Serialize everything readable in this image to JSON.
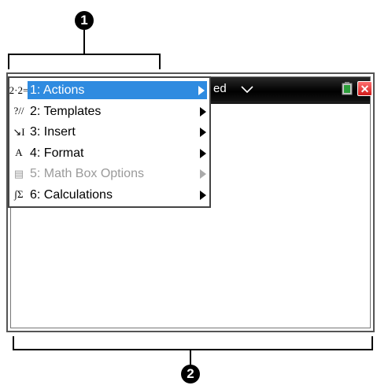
{
  "callouts": {
    "top": "1",
    "bottom": "2"
  },
  "document": {
    "title_partial": "ed"
  },
  "menu": {
    "items": [
      {
        "label": "1: Actions",
        "icon": "2·2=",
        "icon_name": "actions-icon",
        "selected": true,
        "disabled": false
      },
      {
        "label": "2: Templates",
        "icon": "?//",
        "icon_name": "templates-icon",
        "selected": false,
        "disabled": false
      },
      {
        "label": "3: Insert",
        "icon": "↘I",
        "icon_name": "insert-icon",
        "selected": false,
        "disabled": false
      },
      {
        "label": "4: Format",
        "icon": "A",
        "icon_name": "format-icon",
        "selected": false,
        "disabled": false
      },
      {
        "label": "5: Math Box Options",
        "icon": "▤",
        "icon_name": "math-box-options-icon",
        "selected": false,
        "disabled": true
      },
      {
        "label": "6: Calculations",
        "icon": "∫Σ",
        "icon_name": "calculations-icon",
        "selected": false,
        "disabled": false
      }
    ]
  },
  "colors": {
    "selection": "#2f8be0",
    "titlebar": "#000000",
    "close": "#d21b1b",
    "disabled_text": "#9a9a9a"
  }
}
